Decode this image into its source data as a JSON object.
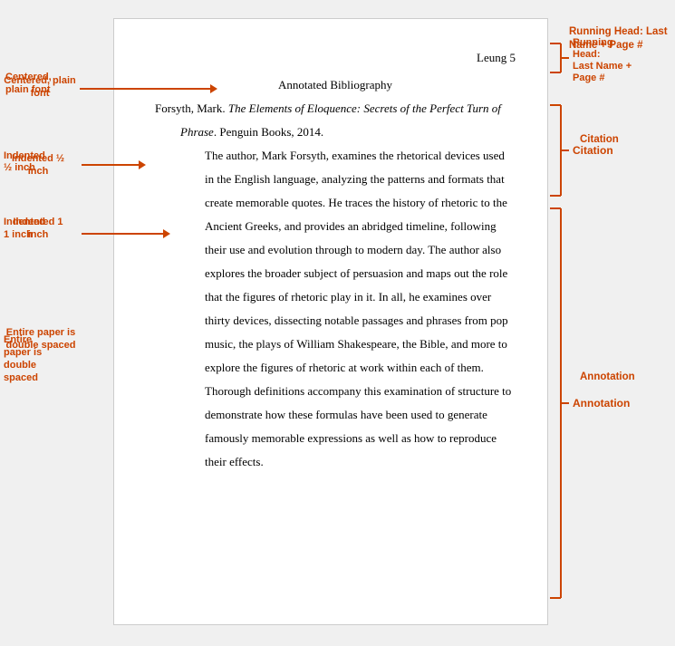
{
  "paper": {
    "running_head": "Leung 5",
    "bib_title": "Annotated Bibliography",
    "citation_line1": "Forsyth, Mark. ",
    "citation_italic": "The Elements of Eloquence: Secrets of the Perfect Turn of",
    "citation_line2": "Phrase",
    "citation_rest": ". Penguin Books, 2014.",
    "annotation": "The author, Mark Forsyth, examines the rhetorical devices used in the English language, analyzing the patterns and formats that create memorable quotes. He traces the history of rhetoric to the Ancient Greeks, and provides an abridged timeline, following their use and evolution through to modern day. The author also explores the broader subject of persuasion and maps out the role that the figures of rhetoric play in it. In all, he examines over thirty devices, dissecting notable passages and phrases from pop music, the plays of William Shakespeare, the Bible, and more to explore the figures of rhetoric at work within each of them. Thorough definitions accompany this examination of structure to demonstrate how these formulas have been used to generate famously memorable expressions as well as how to reproduce their effects."
  },
  "labels": {
    "centered": "Centered, plain font",
    "half_inch": "Indented ½ inch",
    "one_inch": "Indented 1 inch",
    "double_spaced": "Entire paper is double spaced",
    "running_head": "Running Head: Last Name + Page #",
    "citation": "Citation",
    "annotation": "Annotation"
  }
}
